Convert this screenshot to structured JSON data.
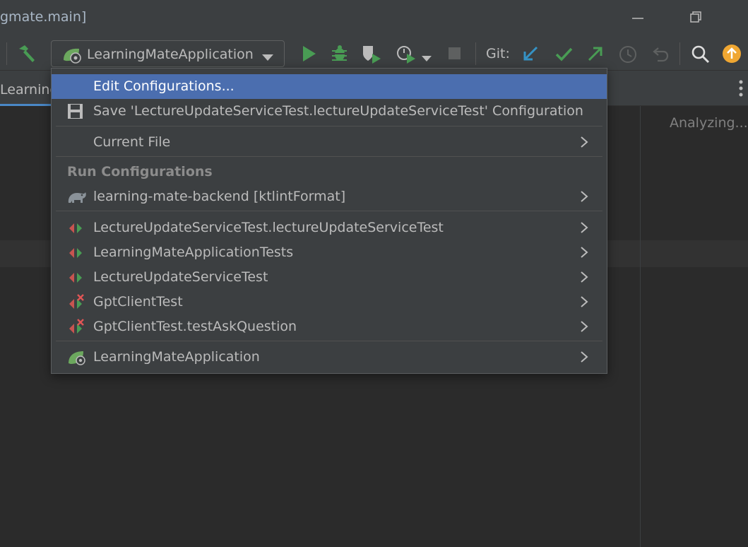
{
  "window": {
    "title": "gmate.main]"
  },
  "toolbar": {
    "run_config_label": "LearningMateApplication",
    "git_label": "Git:"
  },
  "tabs": {
    "active_label": "Learning"
  },
  "editor": {
    "status": "Analyzing..."
  },
  "popup": {
    "items_top": [
      {
        "label": "Edit Configurations...",
        "icon": "none",
        "selected": true
      },
      {
        "label": "Save 'LectureUpdateServiceTest.lectureUpdateServiceTest' Configuration",
        "icon": "save-icon"
      },
      {
        "label": "Current File",
        "icon": "none",
        "submenu": true
      }
    ],
    "section_header": "Run Configurations",
    "gradle_item": {
      "label": "learning-mate-backend [ktlintFormat]",
      "icon": "gradle-elephant-icon"
    },
    "test_items": [
      {
        "label": "LectureUpdateServiceTest.lectureUpdateServiceTest",
        "icon": "junit-test-icon"
      },
      {
        "label": "LearningMateApplicationTests",
        "icon": "junit-test-icon"
      },
      {
        "label": "LectureUpdateServiceTest",
        "icon": "junit-test-icon"
      },
      {
        "label": "GptClientTest",
        "icon": "junit-test-failed-icon"
      },
      {
        "label": "GptClientTest.testAskQuestion",
        "icon": "junit-test-failed-icon"
      }
    ],
    "app_item": {
      "label": "LearningMateApplication",
      "icon": "spring-boot-icon"
    }
  },
  "colors": {
    "selection": "#4b6eaf",
    "run_green": "#499c54",
    "git_blue": "#3592c4",
    "update_orange": "#f0a732"
  }
}
